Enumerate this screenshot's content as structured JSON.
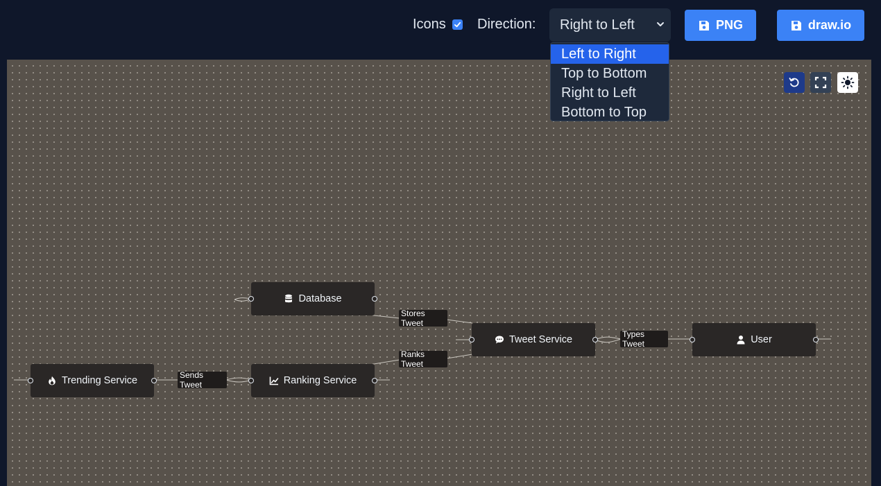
{
  "toolbar": {
    "icons_label": "Icons",
    "icons_checked": true,
    "direction_label": "Direction:",
    "direction_value": "Right to Left",
    "png_label": "PNG",
    "drawio_label": "draw.io",
    "accent_color": "#3b82f6"
  },
  "direction_menu": {
    "options": [
      "Left to Right",
      "Top to Bottom",
      "Right to Left",
      "Bottom to Top"
    ],
    "highlighted": "Left to Right"
  },
  "canvas_controls": {
    "icons": [
      "reset-icon",
      "fullscreen-icon",
      "sun-icon"
    ]
  },
  "diagram": {
    "nodes": {
      "database": {
        "label": "Database",
        "icon": "database-icon"
      },
      "tweet_service": {
        "label": "Tweet Service",
        "icon": "comment-icon"
      },
      "user": {
        "label": "User",
        "icon": "user-icon"
      },
      "trending_service": {
        "label": "Trending Service",
        "icon": "fire-icon"
      },
      "ranking_service": {
        "label": "Ranking Service",
        "icon": "chart-line-icon"
      }
    },
    "edges": {
      "stores_tweet": "Stores Tweet",
      "ranks_tweet": "Ranks Tweet",
      "types_tweet": "Types Tweet",
      "sends_tweet": "Sends Tweet"
    },
    "canvas_background": "#58524b",
    "node_background": "#2a2726"
  }
}
